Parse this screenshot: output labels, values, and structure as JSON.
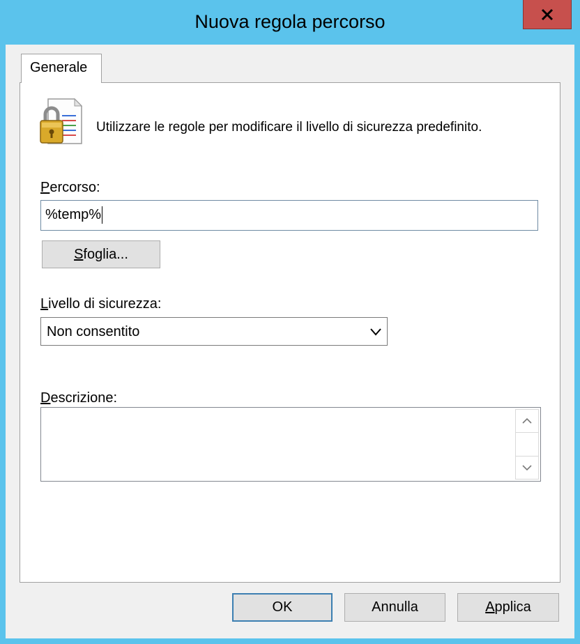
{
  "window": {
    "title": "Nuova regola percorso",
    "close_glyph": "✕"
  },
  "tabs": [
    {
      "label": "Generale"
    }
  ],
  "intro": {
    "icon": "lock-document-icon",
    "text": "Utilizzare le regole per modificare il livello di sicurezza predefinito."
  },
  "path": {
    "label_accesskey": "P",
    "label_rest": "ercorso:",
    "value": "%temp%"
  },
  "browse": {
    "accesskey": "S",
    "rest": "foglia..."
  },
  "security_level": {
    "label_accesskey": "L",
    "label_rest": "ivello di sicurezza:",
    "selected": "Non consentito"
  },
  "description": {
    "label_accesskey": "D",
    "label_rest": "escrizione:",
    "value": ""
  },
  "footer": {
    "ok_label": "OK",
    "cancel_label": "Annulla",
    "apply_accesskey": "A",
    "apply_rest": "pplica"
  },
  "colors": {
    "titlebar": "#5bc3ec",
    "close_button": "#c7504d",
    "dialog_bg": "#f0f0f0",
    "focus_border": "#3c7fb1"
  }
}
